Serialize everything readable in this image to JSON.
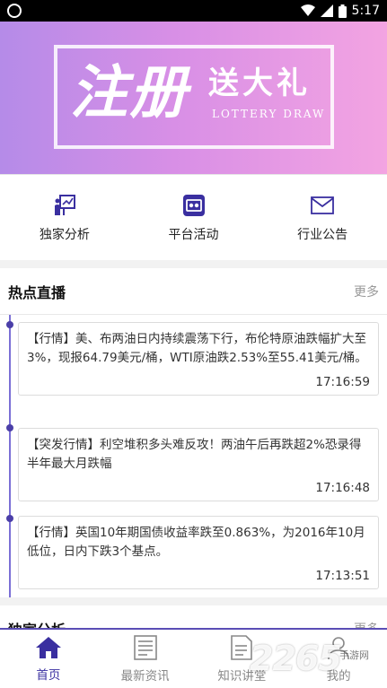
{
  "status_bar": {
    "time": "5:17"
  },
  "banner": {
    "title_big": "注册",
    "title_small": "送大礼",
    "subtitle_en": "LOTTERY DRAW"
  },
  "quick_nav": [
    {
      "label": "独家分析",
      "icon": "analysis-chart-icon"
    },
    {
      "label": "平台活动",
      "icon": "activity-icon"
    },
    {
      "label": "行业公告",
      "icon": "envelope-icon"
    }
  ],
  "hot_live": {
    "title": "热点直播",
    "more": "更多",
    "items": [
      {
        "text": "【行情】美、布两油日内持续震荡下行，布伦特原油跌幅扩大至3%，现报64.79美元/桶，WTI原油跌2.53%至55.41美元/桶。",
        "time": "17:16:59"
      },
      {
        "text": "【突发行情】利空堆积多头难反攻！两油午后再跌超2%恐录得半年最大月跌幅",
        "time": "17:16:48"
      },
      {
        "text": "【行情】英国10年期国债收益率跌至0.863%，为2016年10月低位，日内下跌3个基点。",
        "time": "17:13:51"
      }
    ]
  },
  "section2": {
    "title": "独家分析",
    "more": "更多"
  },
  "tab_bar": [
    {
      "label": "首页",
      "active": true,
      "icon": "home-icon"
    },
    {
      "label": "最新资讯",
      "active": false,
      "icon": "news-icon"
    },
    {
      "label": "知识讲堂",
      "active": false,
      "icon": "document-icon"
    },
    {
      "label": "我的",
      "active": false,
      "icon": "user-icon"
    }
  ],
  "watermark": {
    "text": "2265",
    "sub": "手游网"
  },
  "colors": {
    "accent": "#3a2fa0",
    "timeline": "#7b6fd6",
    "banner_left": "#b58be8",
    "banner_right": "#f3a4e2"
  }
}
